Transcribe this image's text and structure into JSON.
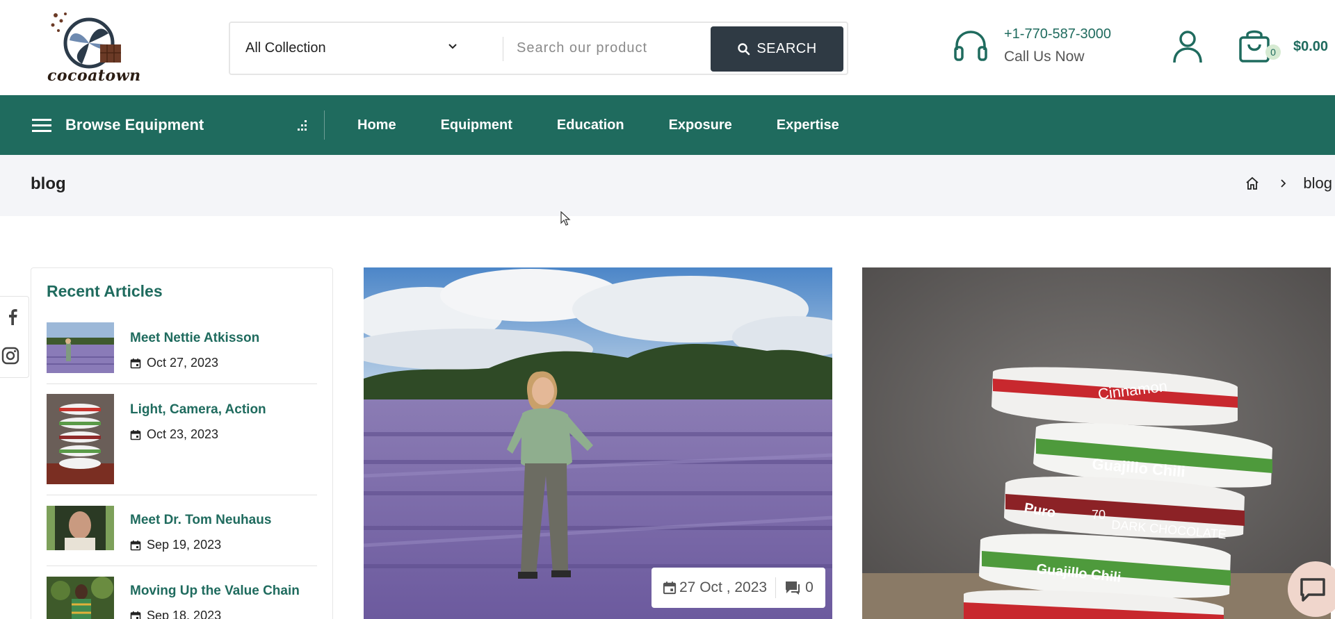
{
  "brand": {
    "logo_text": "cocoatown"
  },
  "search": {
    "collection_selected": "All Collection",
    "placeholder": "Search our product",
    "button_label": "SEARCH"
  },
  "support": {
    "phone": "+1-770-587-3000",
    "label": "Call Us Now"
  },
  "cart": {
    "count": "0",
    "total": "$0.00"
  },
  "nav": {
    "browse_label": "Browse Equipment",
    "links": [
      "Home",
      "Equipment",
      "Education",
      "Exposure",
      "Expertise"
    ]
  },
  "page": {
    "title": "blog",
    "breadcrumb_current": "blog"
  },
  "sidebar": {
    "heading": "Recent Articles",
    "articles": [
      {
        "title": "Meet Nettie Atkisson",
        "date": "Oct 27, 2023"
      },
      {
        "title": "Light, Camera, Action",
        "date": "Oct 23, 2023"
      },
      {
        "title": "Meet Dr. Tom Neuhaus",
        "date": "Sep 19, 2023"
      },
      {
        "title": "Moving Up the Value Chain",
        "date": "Sep 18, 2023"
      }
    ]
  },
  "posts": [
    {
      "date": "27 Oct , 2023",
      "comments": "0"
    }
  ],
  "post_image_labels": [
    "Cinnamon",
    "Guajillo Chili",
    "Puro",
    "70",
    "DARK CHOCOLATE",
    "Guajillo Chili"
  ],
  "icons": {
    "social": [
      "facebook-icon",
      "instagram-icon"
    ],
    "header": [
      "headset-icon",
      "user-icon",
      "shopping-bag-icon",
      "search-icon"
    ]
  },
  "colors": {
    "brand_green": "#1f6b5e",
    "search_button": "#2f3a44",
    "band_bg": "#f4f5f8"
  }
}
